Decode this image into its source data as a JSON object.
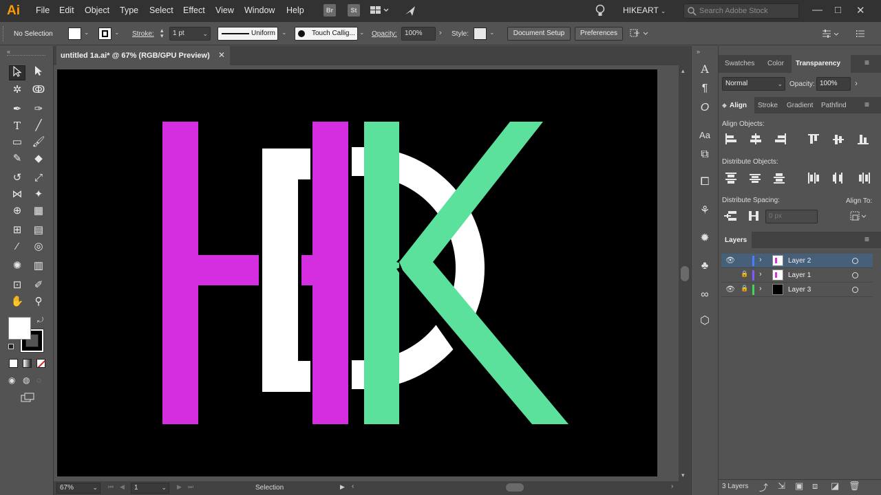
{
  "app": {
    "logo": "Ai",
    "menu": [
      "File",
      "Edit",
      "Object",
      "Type",
      "Select",
      "Effect",
      "View",
      "Window",
      "Help"
    ],
    "badges": [
      "Br",
      "St"
    ],
    "workspace": "HIKEART",
    "stock_search_placeholder": "Search Adobe Stock",
    "window_controls": [
      "—",
      "□",
      "✕"
    ]
  },
  "controlbar": {
    "selection": "No Selection",
    "stroke_label": "Stroke:",
    "stroke_weight": "1 pt",
    "profile": "Uniform",
    "brush": "Touch Callig...",
    "opacity_label": "Opacity:",
    "opacity": "100%",
    "style_label": "Style:",
    "document_setup": "Document Setup",
    "preferences": "Preferences"
  },
  "document": {
    "tab_title": "untitled 1a.ai* @ 67% (RGB/GPU Preview)",
    "close_glyph": "✕"
  },
  "artwork": {
    "colors": {
      "magenta": "#d52ee0",
      "green": "#5ce19d",
      "white": "#ffffff",
      "black": "#000000"
    }
  },
  "statusbar": {
    "zoom": "67%",
    "artboard_number": "1",
    "status": "Selection"
  },
  "panels": {
    "top_tabs": [
      "Swatches",
      "Color",
      "Transparency"
    ],
    "blend_mode": "Normal",
    "opacity_label": "Opacity:",
    "opacity": "100%",
    "align_tabs": [
      "Align",
      "Stroke",
      "Gradient",
      "Pathfind"
    ],
    "align_objects": "Align Objects:",
    "distribute_objects": "Distribute Objects:",
    "distribute_spacing": "Distribute Spacing:",
    "align_to": "Align To:",
    "spacing_value": "0 px",
    "layers_tab": "Layers",
    "layers": [
      {
        "name": "Layer 2",
        "color": "#4f7cff",
        "visible": true,
        "locked": false,
        "selected": true
      },
      {
        "name": "Layer 1",
        "color": "#7a5cff",
        "visible": false,
        "locked": true,
        "selected": false
      },
      {
        "name": "Layer 3",
        "color": "#3fd65a",
        "visible": true,
        "locked": true,
        "selected": false
      }
    ],
    "layers_count": "3 Layers"
  }
}
